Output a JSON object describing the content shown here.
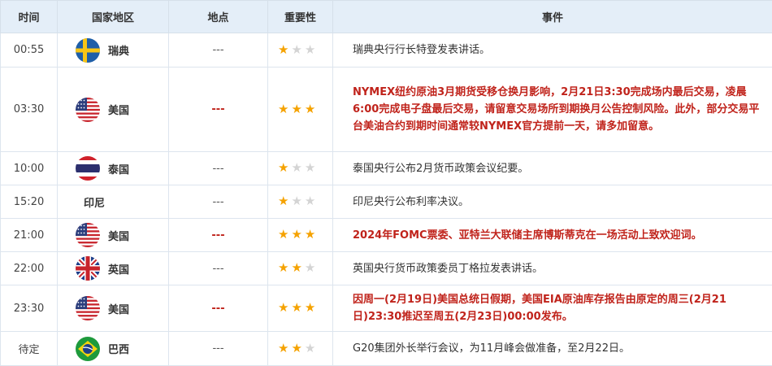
{
  "headers": {
    "time": "时间",
    "country": "国家地区",
    "location": "地点",
    "importance": "重要性",
    "event": "事件"
  },
  "rows": [
    {
      "time": "00:55",
      "country": "瑞典",
      "flag": "sweden-flag-icon",
      "location": "---",
      "stars": 1,
      "event": "瑞典央行行长特登发表讲话。",
      "highlight": false
    },
    {
      "time": "03:30",
      "country": "美国",
      "flag": "usa-flag-icon",
      "location": "---",
      "stars": 3,
      "event": "NYMEX纽约原油3月期货受移仓换月影响，2月21日3:30完成场内最后交易，凌晨6:00完成电子盘最后交易，请留意交易场所到期换月公告控制风险。此外，部分交易平台美油合约到期时间通常较NYMEX官方提前一天，请多加留意。",
      "highlight": true
    },
    {
      "time": "10:00",
      "country": "泰国",
      "flag": "thailand-flag-icon",
      "location": "---",
      "stars": 1,
      "event": "泰国央行公布2月货币政策会议纪要。",
      "highlight": false
    },
    {
      "time": "15:20",
      "country": "印尼",
      "flag": "",
      "location": "---",
      "stars": 1,
      "event": "印尼央行公布利率决议。",
      "highlight": false
    },
    {
      "time": "21:00",
      "country": "美国",
      "flag": "usa-flag-icon",
      "location": "---",
      "stars": 3,
      "event": "2024年FOMC票委、亚特兰大联储主席博斯蒂克在一场活动上致欢迎词。",
      "highlight": true
    },
    {
      "time": "22:00",
      "country": "英国",
      "flag": "uk-flag-icon",
      "location": "---",
      "stars": 2,
      "event": "英国央行货币政策委员丁格拉发表讲话。",
      "highlight": false
    },
    {
      "time": "23:30",
      "country": "美国",
      "flag": "usa-flag-icon",
      "location": "---",
      "stars": 3,
      "event": "因周一(2月19日)美国总统日假期，美国EIA原油库存报告由原定的周三(2月21日)23:30推迟至周五(2月23日)00:00发布。",
      "highlight": true
    },
    {
      "time": "待定",
      "country": "巴西",
      "flag": "brazil-flag-icon",
      "location": "---",
      "stars": 2,
      "event": "G20集团外长举行会议，为11月峰会做准备，至2月22日。",
      "highlight": false
    }
  ],
  "colors": {
    "highlight_text": "#c0231b",
    "star_on": "#f5a200",
    "star_off": "#d4d4d4",
    "header_bg": "#e4eef8"
  }
}
